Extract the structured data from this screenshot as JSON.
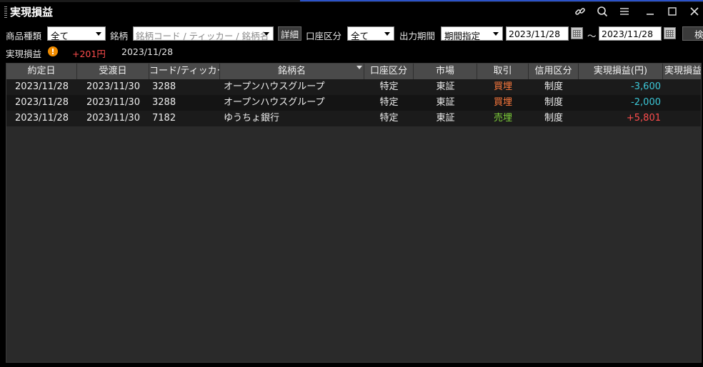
{
  "window": {
    "title": "実現損益",
    "icons": [
      "link-icon",
      "search-icon",
      "menu-icon",
      "minimize-icon",
      "maximize-icon",
      "close-icon"
    ]
  },
  "filters": {
    "product_type_label": "商品種類",
    "product_type_value": "全て",
    "symbol_label": "銘柄",
    "symbol_placeholder": "銘柄コード / ティッカー / 銘柄名",
    "detail_button": "詳細",
    "account_type_label": "口座区分",
    "account_type_value": "全て",
    "period_label": "出力期間",
    "period_value": "期間指定",
    "date_from": "2023/11/28",
    "range_sep": "～",
    "date_to": "2023/11/28",
    "search_button": "検"
  },
  "summary": {
    "label": "実現損益",
    "amount": "+201円",
    "date": "2023/11/28"
  },
  "colors": {
    "positive": "#ff4d4d",
    "negative": "#3cc8d8",
    "buy": "#ff7a3d",
    "sell": "#7fd23a"
  },
  "table": {
    "columns": [
      "約定日",
      "受渡日",
      "コード/ティッカー",
      "銘柄名",
      "口座区分",
      "市場",
      "取引",
      "信用区分",
      "実現損益(円)",
      "実現損益"
    ],
    "rows": [
      {
        "trade_date": "2023/11/28",
        "settle_date": "2023/11/30",
        "code": "3288",
        "name": "オープンハウスグループ",
        "account": "特定",
        "market": "東証",
        "side": "買埋",
        "side_type": "buy",
        "margin": "制度",
        "pnl": "-3,600",
        "pnl_sign": "negative"
      },
      {
        "trade_date": "2023/11/28",
        "settle_date": "2023/11/30",
        "code": "3288",
        "name": "オープンハウスグループ",
        "account": "特定",
        "market": "東証",
        "side": "買埋",
        "side_type": "buy",
        "margin": "制度",
        "pnl": "-2,000",
        "pnl_sign": "negative"
      },
      {
        "trade_date": "2023/11/28",
        "settle_date": "2023/11/30",
        "code": "7182",
        "name": "ゆうちょ銀行",
        "account": "特定",
        "market": "東証",
        "side": "売埋",
        "side_type": "sell",
        "margin": "制度",
        "pnl": "+5,801",
        "pnl_sign": "positive"
      }
    ]
  }
}
